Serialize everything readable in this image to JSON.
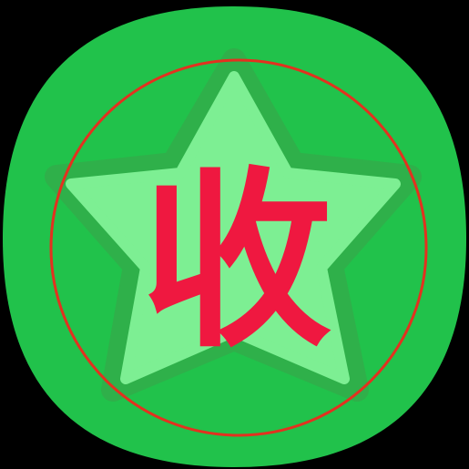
{
  "app_icon": {
    "glyph": "收",
    "icon_name": "favorite-star-icon",
    "colors": {
      "background": "#000000",
      "squircle": "#21c24b",
      "ring": "#e3311f",
      "star_outer": "#2fb04a",
      "star_fill": "#7def93",
      "glyph": "#ef1840"
    }
  }
}
